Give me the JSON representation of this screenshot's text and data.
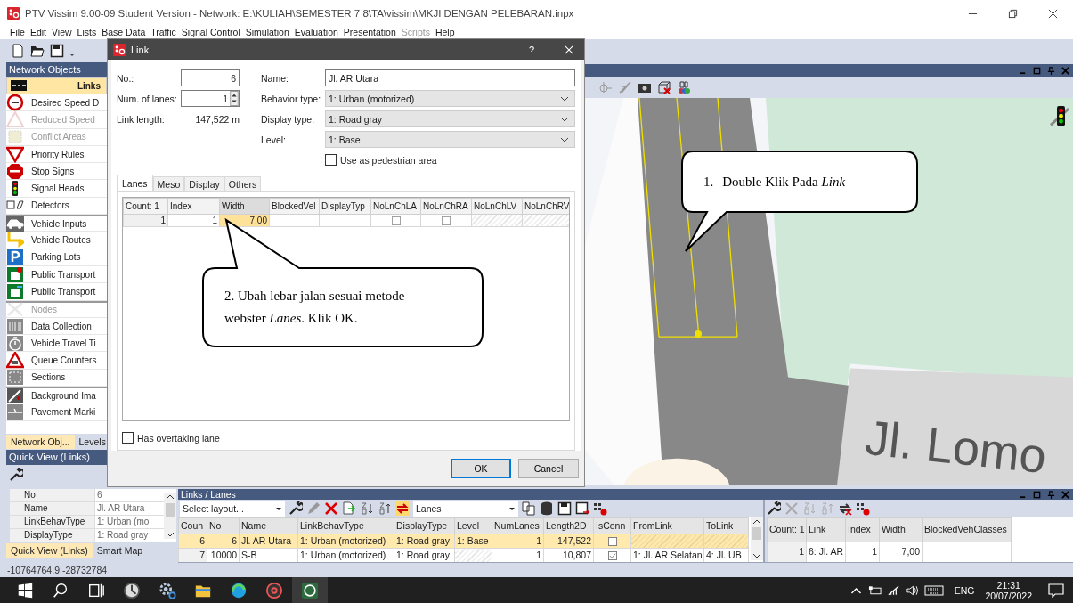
{
  "window": {
    "title": "PTV Vissim 9.00-09 Student Version - Network: E:\\KULIAH\\SEMESTER 7 8\\TA\\vissim\\MKJI DENGAN PELEBARAN.inpx"
  },
  "menu": [
    {
      "label": "File",
      "disabled": false
    },
    {
      "label": "Edit",
      "disabled": false
    },
    {
      "label": "View",
      "disabled": false
    },
    {
      "label": "Lists",
      "disabled": false
    },
    {
      "label": "Base Data",
      "disabled": false
    },
    {
      "label": "Traffic",
      "disabled": false
    },
    {
      "label": "Signal Control",
      "disabled": false
    },
    {
      "label": "Simulation",
      "disabled": false
    },
    {
      "label": "Evaluation",
      "disabled": false
    },
    {
      "label": "Presentation",
      "disabled": false
    },
    {
      "label": "Scripts",
      "disabled": true
    },
    {
      "label": "Help",
      "disabled": false
    }
  ],
  "network_objects": {
    "title": "Network Objects",
    "items": [
      {
        "label": "Links",
        "selected": true,
        "disabled": false
      },
      {
        "label": "Desired Speed D",
        "selected": false,
        "disabled": false
      },
      {
        "label": "Reduced Speed",
        "selected": false,
        "disabled": true
      },
      {
        "label": "Conflict Areas",
        "selected": false,
        "disabled": true
      },
      {
        "label": "Priority Rules",
        "selected": false,
        "disabled": false
      },
      {
        "label": "Stop Signs",
        "selected": false,
        "disabled": false
      },
      {
        "label": "Signal Heads",
        "selected": false,
        "disabled": false
      },
      {
        "label": "Detectors",
        "selected": false,
        "disabled": false
      },
      {
        "label": "Vehicle Inputs",
        "selected": false,
        "disabled": false
      },
      {
        "label": "Vehicle Routes",
        "selected": false,
        "disabled": false
      },
      {
        "label": "Parking Lots",
        "selected": false,
        "disabled": false
      },
      {
        "label": "Public Transport",
        "selected": false,
        "disabled": false
      },
      {
        "label": "Public Transport",
        "selected": false,
        "disabled": false
      },
      {
        "label": "Nodes",
        "selected": false,
        "disabled": true
      },
      {
        "label": "Data Collection",
        "selected": false,
        "disabled": false
      },
      {
        "label": "Vehicle Travel Ti",
        "selected": false,
        "disabled": false
      },
      {
        "label": "Queue Counters",
        "selected": false,
        "disabled": false
      },
      {
        "label": "Sections",
        "selected": false,
        "disabled": false
      },
      {
        "label": "Background Ima",
        "selected": false,
        "disabled": false
      },
      {
        "label": "Pavement Marki",
        "selected": false,
        "disabled": false
      }
    ],
    "tabs": [
      {
        "label": "Network Obj...",
        "selected": true
      },
      {
        "label": "Levels",
        "selected": false
      }
    ]
  },
  "quick_view": {
    "title": "Quick View (Links)",
    "rows": [
      {
        "name": "No",
        "value": "6"
      },
      {
        "name": "Name",
        "value": "Jl. AR Utara"
      },
      {
        "name": "LinkBehavType",
        "value": "1: Urban (mo"
      },
      {
        "name": "DisplayType",
        "value": "1: Road gray"
      }
    ],
    "tabs": [
      {
        "label": "Quick View (Links)",
        "selected": true
      },
      {
        "label": "Smart Map",
        "selected": false
      }
    ]
  },
  "network_view": {
    "map_label": "Jl. Lomo"
  },
  "dialog": {
    "title": "Link",
    "help": "?",
    "no_label": "No.:",
    "no_value": "6",
    "lanes_label": "Num. of lanes:",
    "lanes_value": "1",
    "length_label": "Link length:",
    "length_value": "147,522 m",
    "name_label": "Name:",
    "name_value": "Jl. AR Utara",
    "behavior_label": "Behavior type:",
    "behavior_value": "1: Urban (motorized)",
    "display_label": "Display type:",
    "display_value": "1: Road gray",
    "level_label": "Level:",
    "level_value": "1: Base",
    "pedestrian": {
      "label": "Use as pedestrian area",
      "checked": false
    },
    "tabs": [
      {
        "label": "Lanes",
        "selected": true
      },
      {
        "label": "Meso",
        "selected": false
      },
      {
        "label": "Display",
        "selected": false
      },
      {
        "label": "Others",
        "selected": false
      }
    ],
    "columns": [
      "Count: 1",
      "Index",
      "Width",
      "BlockedVel",
      "DisplayTyp",
      "NoLnChLA",
      "NoLnChRA",
      "NoLnChLV",
      "NoLnChRV"
    ],
    "rows": [
      {
        "cells": [
          {
            "kind": "head",
            "text": "1"
          },
          {
            "kind": "text",
            "text": "1",
            "selected": false
          },
          {
            "kind": "text",
            "text": "7,00",
            "selected": true
          },
          {
            "kind": "empty"
          },
          {
            "kind": "empty"
          },
          {
            "kind": "checkbox",
            "checked": false
          },
          {
            "kind": "checkbox",
            "checked": false
          },
          {
            "kind": "hatched"
          },
          {
            "kind": "hatched"
          }
        ]
      }
    ],
    "overtaking": {
      "label": "Has overtaking lane",
      "checked": false
    },
    "buttons": [
      {
        "label": "OK",
        "default": true
      },
      {
        "label": "Cancel",
        "default": false
      }
    ]
  },
  "callouts": [
    {
      "number": "1.",
      "text": "Double Klik Pada *Link*"
    },
    {
      "text": "2. Ubah lebar jalan sesuai metode webster *Lanes*. Klik OK."
    }
  ],
  "links_lanes": {
    "title": "Links / Lanes",
    "layout_placeholder": "Select layout...",
    "relation": "Lanes",
    "columns": [
      "Coun",
      "No",
      "Name",
      "LinkBehavType",
      "DisplayType",
      "Level",
      "NumLanes",
      "Length2D",
      "IsConn",
      "FromLink",
      "ToLink"
    ],
    "rows": [
      {
        "selected": true,
        "cells": [
          {
            "kind": "head",
            "text": "6"
          },
          {
            "kind": "text",
            "text": "6"
          },
          {
            "kind": "text",
            "text": "Jl. AR Utara"
          },
          {
            "kind": "text",
            "text": "1: Urban (motorized)"
          },
          {
            "kind": "text",
            "text": "1: Road gray"
          },
          {
            "kind": "text",
            "text": "1: Base"
          },
          {
            "kind": "text",
            "text": "1"
          },
          {
            "kind": "text",
            "text": "147,522"
          },
          {
            "kind": "checkbox",
            "checked": false
          },
          {
            "kind": "hatched"
          },
          {
            "kind": "hatched"
          }
        ]
      },
      {
        "selected": false,
        "cells": [
          {
            "kind": "head",
            "text": "7"
          },
          {
            "kind": "text",
            "text": "10000"
          },
          {
            "kind": "text",
            "text": "S-B"
          },
          {
            "kind": "text",
            "text": "1: Urban (motorized)"
          },
          {
            "kind": "text",
            "text": "1: Road gray"
          },
          {
            "kind": "hatched"
          },
          {
            "kind": "text",
            "text": "1"
          },
          {
            "kind": "text",
            "text": "10,807"
          },
          {
            "kind": "checkbox",
            "checked": true
          },
          {
            "kind": "text",
            "text": "1: Jl. AR Selatan"
          },
          {
            "kind": "text",
            "text": "4: Jl. UB"
          }
        ]
      }
    ],
    "detail_columns": [
      "Count: 1",
      "Link",
      "Index",
      "Width",
      "BlockedVehClasses"
    ],
    "detail_rows": [
      {
        "cells": [
          {
            "kind": "head",
            "text": "1"
          },
          {
            "kind": "text",
            "text": "6: Jl. AR"
          },
          {
            "kind": "text",
            "text": "1"
          },
          {
            "kind": "text",
            "text": "7,00"
          },
          {
            "kind": "empty"
          }
        ]
      }
    ]
  },
  "status_bar": {
    "coords": "-10764764.9:-28732784"
  },
  "taskbar": {
    "apps": [
      {
        "selected": false
      },
      {
        "selected": false
      },
      {
        "selected": false
      },
      {
        "selected": false
      },
      {
        "selected": false
      },
      {
        "selected": false
      },
      {
        "selected": false
      },
      {
        "selected": false
      },
      {
        "selected": true
      }
    ],
    "language": "ENG",
    "time": "21:31",
    "date": "20/07/2022"
  }
}
